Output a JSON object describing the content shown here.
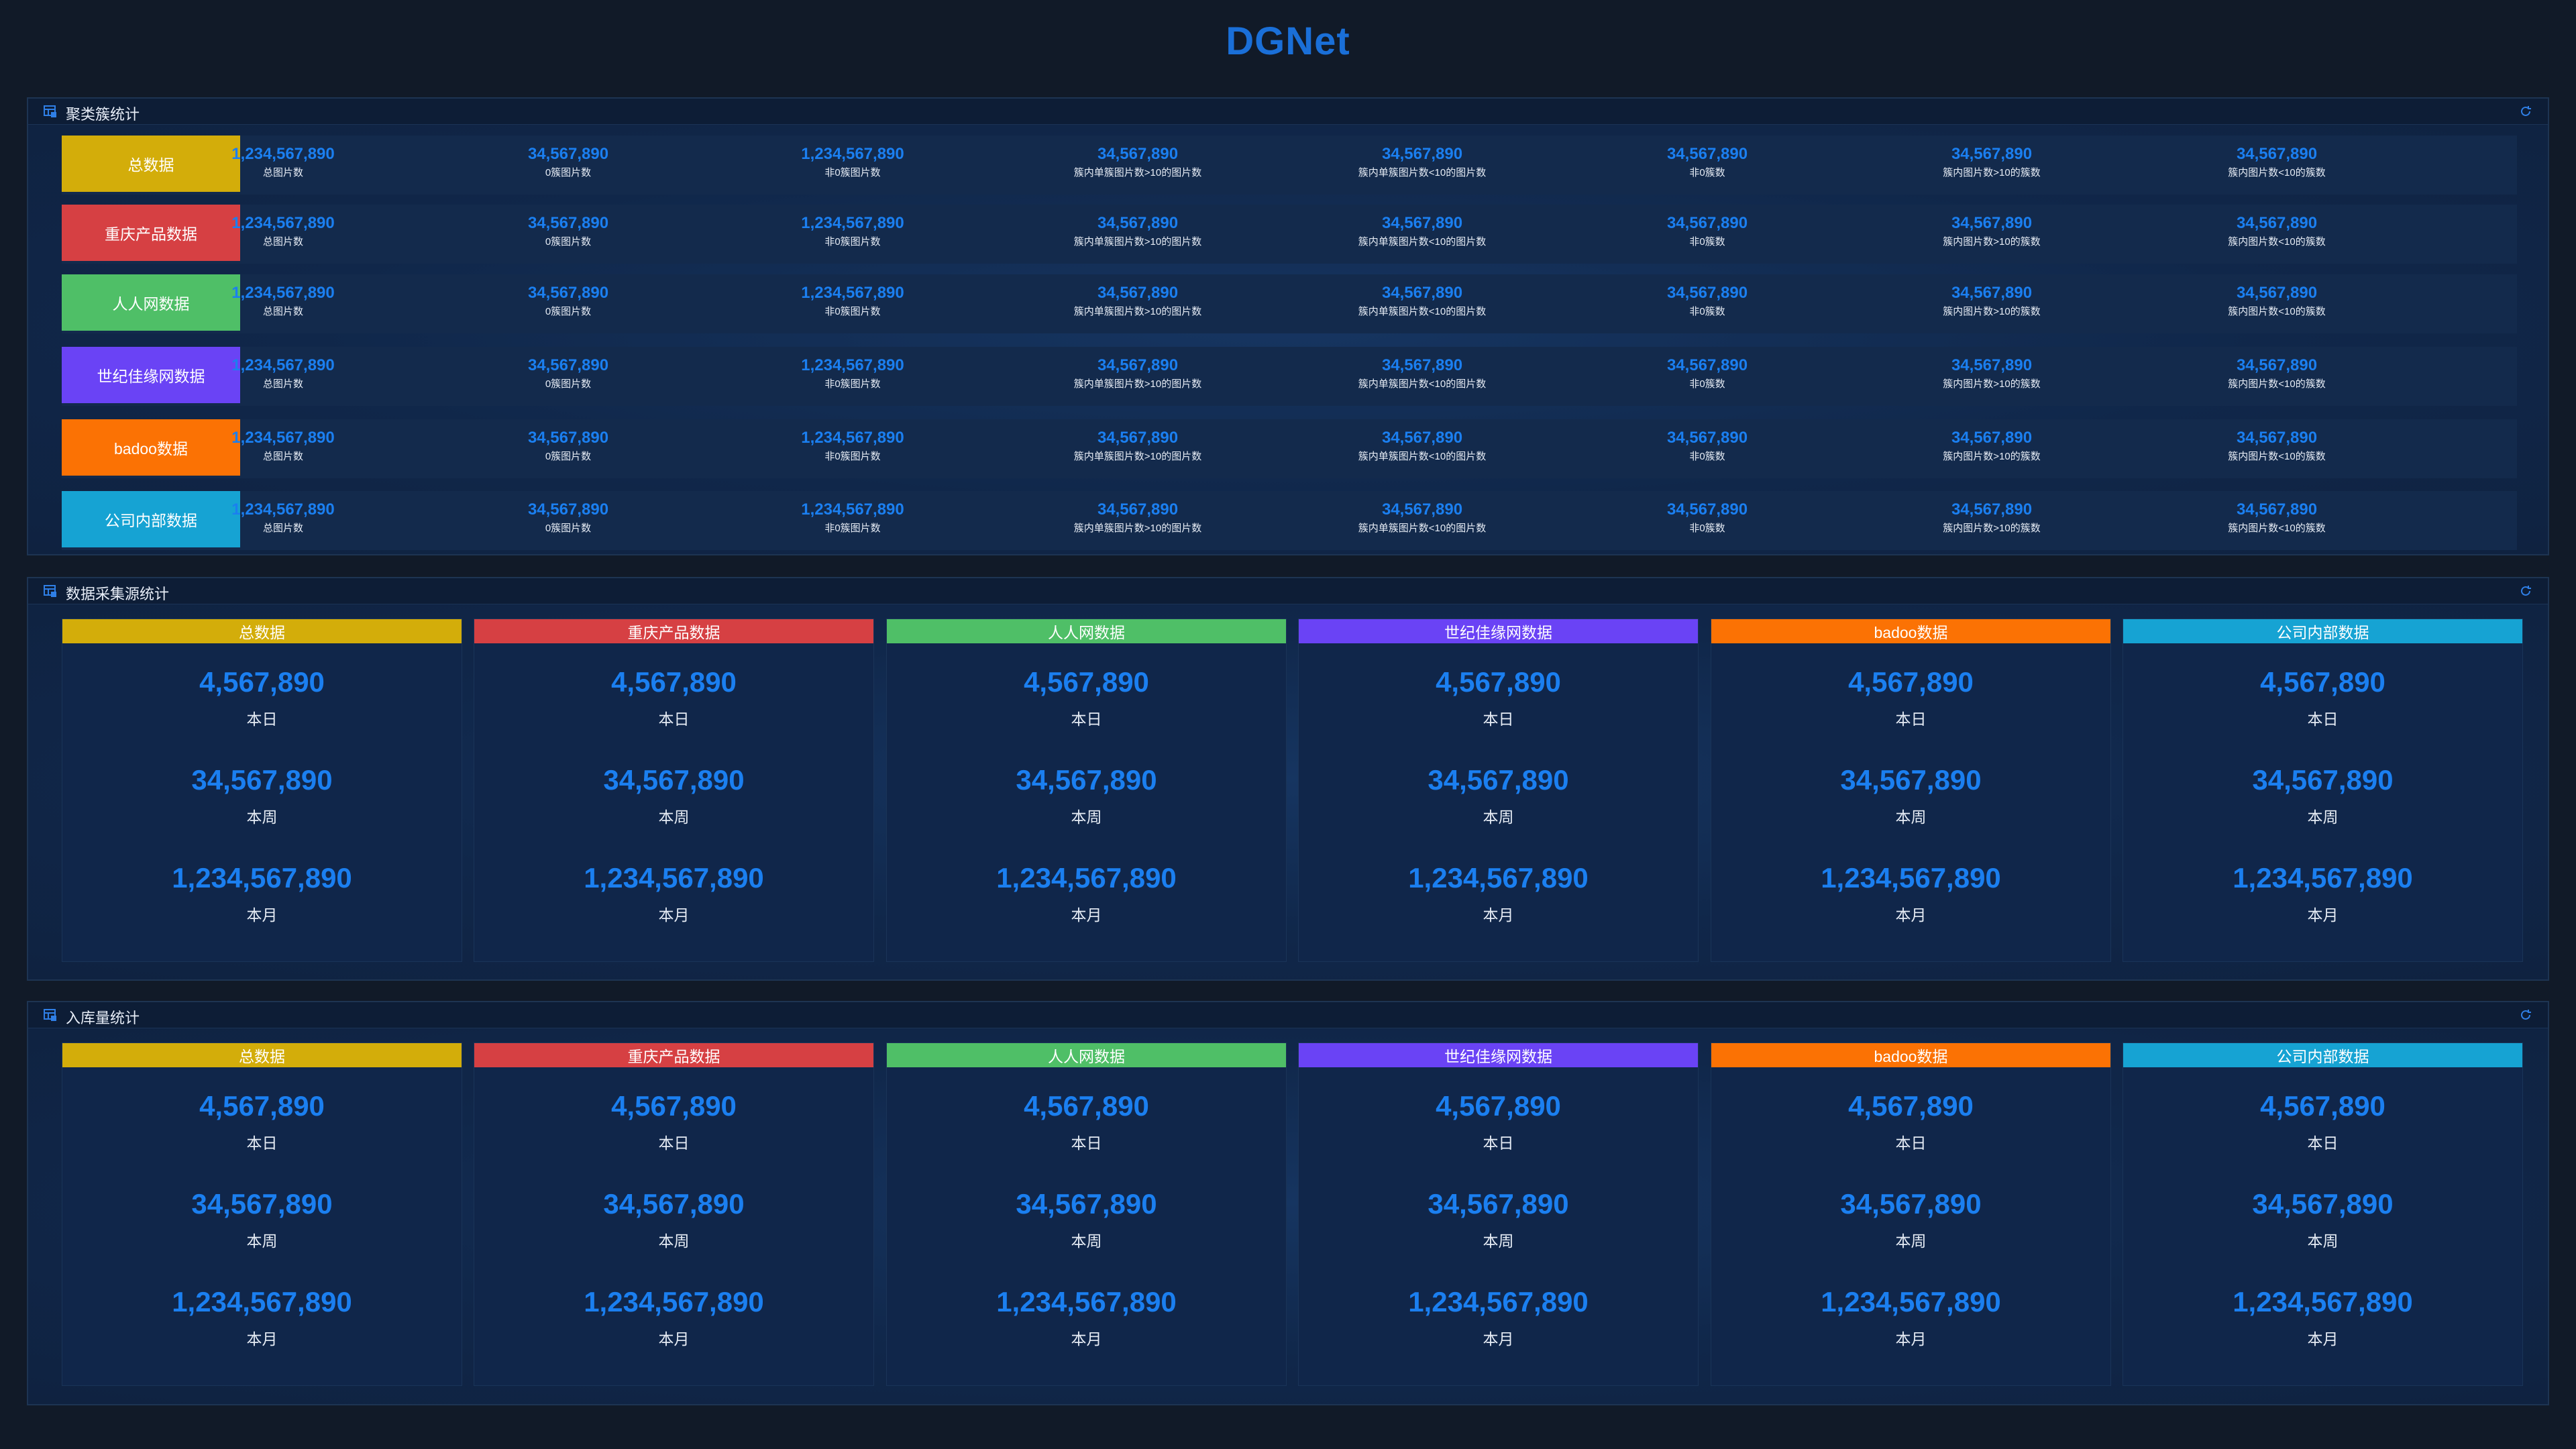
{
  "app": {
    "title": "DGNet"
  },
  "colors": {
    "gold": "#d3ad0a",
    "red": "#d64043",
    "green": "#4fbf67",
    "purple": "#6a43f5",
    "orange": "#fb7204",
    "cyan": "#16a3d3",
    "accent": "#1b7ff0"
  },
  "cluster_panel": {
    "title": "聚类簇统计",
    "rows": [
      {
        "label": "总数据",
        "color": "#d3ad0a"
      },
      {
        "label": "重庆产品数据",
        "color": "#d64043"
      },
      {
        "label": "人人网数据",
        "color": "#4fbf67"
      },
      {
        "label": "世纪佳缘网数据",
        "color": "#6a43f5"
      },
      {
        "label": "badoo数据",
        "color": "#fb7204"
      },
      {
        "label": "公司内部数据",
        "color": "#16a3d3"
      }
    ],
    "metrics": [
      {
        "value": "1,234,567,890",
        "caption": "总图片数"
      },
      {
        "value": "34,567,890",
        "caption": "0簇图片数"
      },
      {
        "value": "1,234,567,890",
        "caption": "非0簇图片数"
      },
      {
        "value": "34,567,890",
        "caption": "簇内单簇图片数>10的图片数"
      },
      {
        "value": "34,567,890",
        "caption": "簇内单簇图片数<10的图片数"
      },
      {
        "value": "34,567,890",
        "caption": "非0簇数"
      },
      {
        "value": "34,567,890",
        "caption": "簇内图片数>10的簇数"
      },
      {
        "value": "34,567,890",
        "caption": "簇内图片数<10的簇数"
      }
    ]
  },
  "collection_panel": {
    "title": "数据采集源统计",
    "cards": [
      {
        "label": "总数据",
        "color": "#d3ad0a"
      },
      {
        "label": "重庆产品数据",
        "color": "#d64043"
      },
      {
        "label": "人人网数据",
        "color": "#4fbf67"
      },
      {
        "label": "世纪佳缘网数据",
        "color": "#6a43f5"
      },
      {
        "label": "badoo数据",
        "color": "#fb7204"
      },
      {
        "label": "公司内部数据",
        "color": "#16a3d3"
      }
    ],
    "stats": [
      {
        "value": "4,567,890",
        "label": "本日"
      },
      {
        "value": "34,567,890",
        "label": "本周"
      },
      {
        "value": "1,234,567,890",
        "label": "本月"
      }
    ]
  },
  "storage_panel": {
    "title": "入库量统计",
    "cards": [
      {
        "label": "总数据",
        "color": "#d3ad0a"
      },
      {
        "label": "重庆产品数据",
        "color": "#d64043"
      },
      {
        "label": "人人网数据",
        "color": "#4fbf67"
      },
      {
        "label": "世纪佳缘网数据",
        "color": "#6a43f5"
      },
      {
        "label": "badoo数据",
        "color": "#fb7204"
      },
      {
        "label": "公司内部数据",
        "color": "#16a3d3"
      }
    ],
    "stats": [
      {
        "value": "4,567,890",
        "label": "本日"
      },
      {
        "value": "34,567,890",
        "label": "本周"
      },
      {
        "value": "1,234,567,890",
        "label": "本月"
      }
    ]
  },
  "icons": {
    "panel": "table-icon",
    "refresh": "refresh-icon"
  }
}
